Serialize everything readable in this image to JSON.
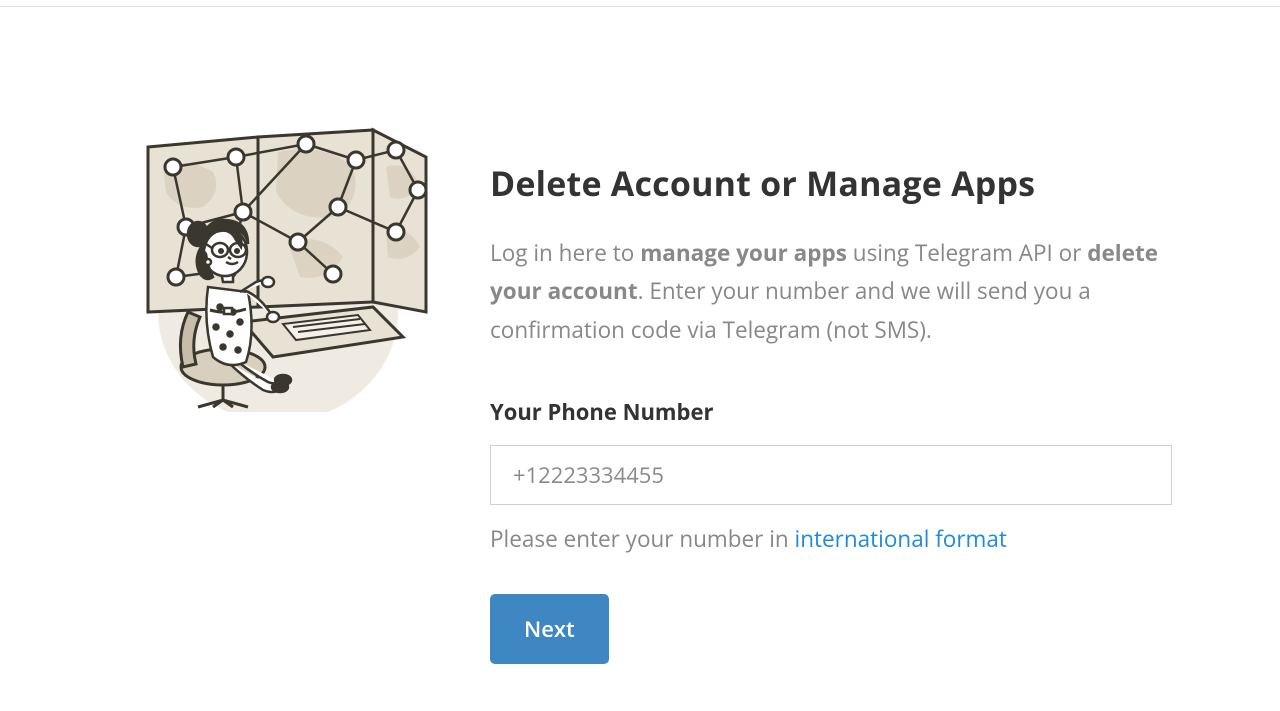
{
  "page": {
    "title": "Delete Account or Manage Apps",
    "description_parts": {
      "p1": "Log in here to ",
      "s1": "manage your apps",
      "p2": " using Telegram API or ",
      "s2": "delete your account",
      "p3": ". Enter your number and we will send you a confirmation code via Telegram (not SMS)."
    }
  },
  "form": {
    "phone_label": "Your Phone Number",
    "phone_placeholder": "+12223334455",
    "help_prefix": "Please enter your number in ",
    "help_link_text": "international format",
    "submit_label": "Next"
  },
  "colors": {
    "accent": "#3e87c2",
    "link": "#1f8be0",
    "text_muted": "#888"
  }
}
